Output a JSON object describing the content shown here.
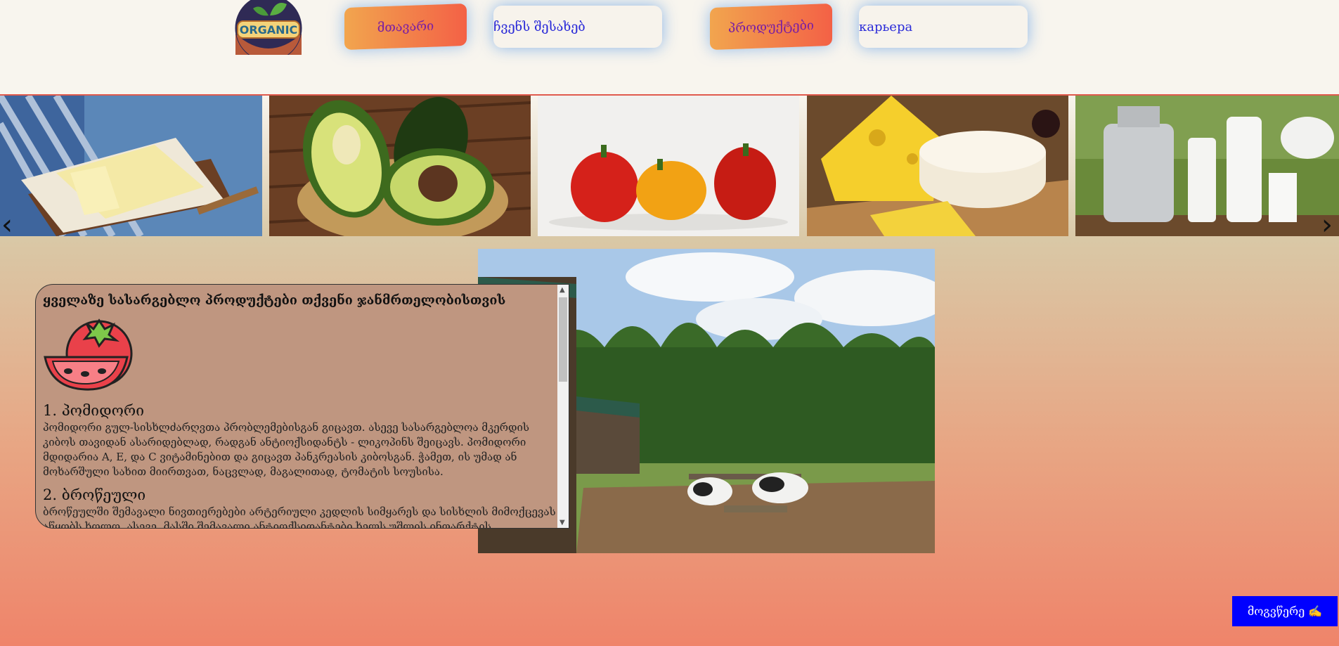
{
  "header": {
    "logo_text": "ORGANIC",
    "nav": [
      {
        "label": "მთავარი",
        "style": "orange"
      },
      {
        "label": "ჩვენს შესახებ",
        "style": "white"
      },
      {
        "label": "პროდუქტები",
        "style": "orange"
      },
      {
        "label": "карьера",
        "style": "white"
      }
    ]
  },
  "carousel": {
    "slides": [
      "butter",
      "avocado",
      "bell-peppers",
      "cheese",
      "milk"
    ],
    "prev_icon": "‹",
    "next_icon": "›"
  },
  "article": {
    "heading": "ყველაზე სასარგებლო პროდუქტები თქვენი ჯანმრთელობისთვის",
    "items": [
      {
        "title": "1. პომიდორი",
        "text": "პომიდორი გულ-სისხლძარღვთა პრობლემებისგან გიცავთ. ასევე სასარგებლოა მკერდის კიბოს თავიდან ასარიდებლად, რადგან ანტიოქსიდანტს - ლიკოპინს შეიცავს. პომიდორი მდიდარია A, E, და C ვიტამინებით და გიცავთ პანკრეასის კიბოსგან. ჭამეთ, ის უმად ან მოხარშული სახით მიირთვათ, ნაცვლად, მაგალითად, ტომატის სოუსისა."
      },
      {
        "title": "2. ბროწეული",
        "text": "ბროწეულში შემავალი ნივთიერებები არტერიული კედლის სიმყარეს და სისხლის მიმოქცევას აწყობს ხოლო, ასევე, მასში შემავალი ანტიოქსიდანტები ხელს უშლის ინფარქტის განვითარებას."
      }
    ]
  },
  "contact": {
    "label": "მოგვწერე ✍"
  },
  "colors": {
    "nav_orange_start": "#f2a54e",
    "nav_orange_end": "#f36146",
    "contact_bg": "#0000ff"
  }
}
